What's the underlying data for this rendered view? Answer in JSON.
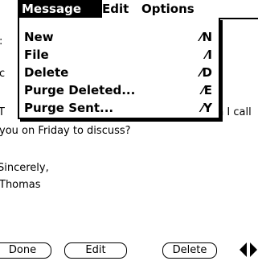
{
  "menubar": {
    "menus": [
      "Message",
      "Edit",
      "Options"
    ]
  },
  "dropdown": {
    "items": [
      {
        "label": "New",
        "shortcut": "⁄N"
      },
      {
        "label": "File",
        "shortcut": "⁄I"
      },
      {
        "label": "Delete",
        "shortcut": "⁄D"
      },
      {
        "label": "Purge Deleted...",
        "shortcut": "⁄E"
      },
      {
        "label": "Purge Sent...",
        "shortcut": "⁄Y"
      }
    ]
  },
  "message": {
    "line_partial_1": ":",
    "line_partial_2": "c",
    "line_partial_3": "T",
    "line_partial_4": "n I call",
    "line_5": "you on Friday to discuss?",
    "line_6": "Sincerely,",
    "line_7": "Thomas"
  },
  "buttons": {
    "done": "Done",
    "edit": "Edit",
    "delete": "Delete"
  }
}
